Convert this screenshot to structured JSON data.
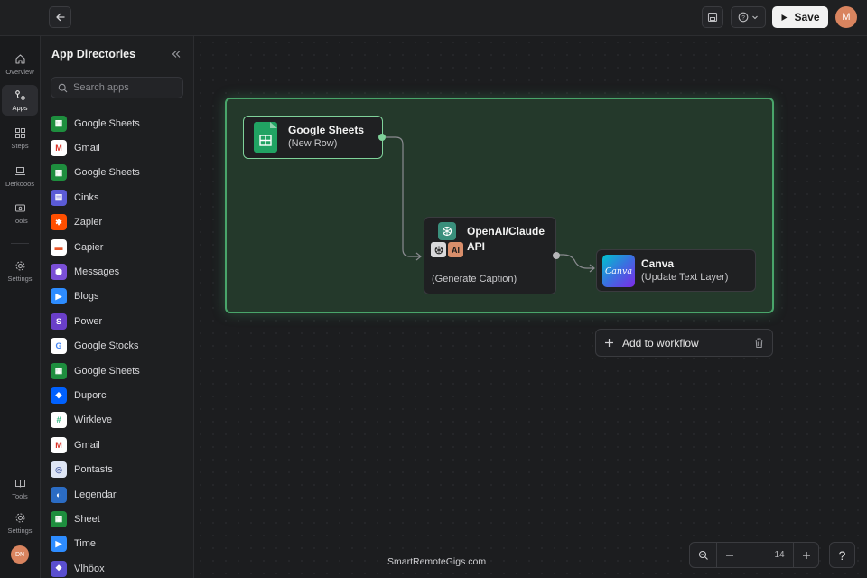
{
  "topbar": {
    "save_label": "Save",
    "avatar_initial": "M"
  },
  "rail": {
    "items": [
      {
        "label": "Overview",
        "icon": "home-icon"
      },
      {
        "label": "Apps",
        "icon": "apps-icon"
      },
      {
        "label": "Steps",
        "icon": "grid-icon"
      },
      {
        "label": "Derkooos",
        "icon": "laptop-icon"
      },
      {
        "label": "Tools",
        "icon": "toolbox-icon"
      },
      {
        "label": "Settings",
        "icon": "gear-icon"
      },
      {
        "label": "Tools",
        "icon": "book-icon"
      },
      {
        "label": "Settings",
        "icon": "gear-icon"
      }
    ],
    "avatar_initials": "DN"
  },
  "panel": {
    "title": "App Directories",
    "search_placeholder": "Search apps",
    "apps": [
      {
        "name": "Google Sheets",
        "icon": "sheets-icon",
        "color": "#1e8e3e"
      },
      {
        "name": "Gmail",
        "icon": "gmail-icon",
        "color": "#ffffff"
      },
      {
        "name": "Google Sheets",
        "icon": "sheets-icon",
        "color": "#1e8e3e"
      },
      {
        "name": "Cinks",
        "icon": "doc-icon",
        "color": "#5b5bd6"
      },
      {
        "name": "Zapier",
        "icon": "zapier-icon",
        "color": "#ff4f00"
      },
      {
        "name": "Capier",
        "icon": "capier-icon",
        "color": "#ffffff"
      },
      {
        "name": "Messages",
        "icon": "messages-icon",
        "color": "#7a4fd6"
      },
      {
        "name": "Blogs",
        "icon": "video-icon",
        "color": "#2d8cff"
      },
      {
        "name": "Power",
        "icon": "power-icon",
        "color": "#6a3fc9"
      },
      {
        "name": "Google Stocks",
        "icon": "google-icon",
        "color": "#ffffff"
      },
      {
        "name": "Google Sheets",
        "icon": "sheets-icon",
        "color": "#1e8e3e"
      },
      {
        "name": "Duporc",
        "icon": "dropbox-icon",
        "color": "#0061fe"
      },
      {
        "name": "Wirklеve",
        "icon": "slack-icon",
        "color": "#ffffff"
      },
      {
        "name": "Gmail",
        "icon": "gmail-icon",
        "color": "#ffffff"
      },
      {
        "name": "Pontasts",
        "icon": "pontasts-icon",
        "color": "#dfe6f5"
      },
      {
        "name": "Legendar",
        "icon": "legendar-icon",
        "color": "#2b6cc4"
      },
      {
        "name": "Sheet",
        "icon": "sheets-icon",
        "color": "#1e8e3e"
      },
      {
        "name": "Time",
        "icon": "video-icon",
        "color": "#2d8cff"
      },
      {
        "name": "Vlhöox",
        "icon": "vlhoox-icon",
        "color": "#5a4fcf"
      }
    ]
  },
  "nodes": {
    "sheets": {
      "title": "Google Sheets",
      "subtitle": "(New Row)"
    },
    "openai": {
      "title_line1": "OpenAI/Claude",
      "title_line2": "API",
      "ai_badge": "AI",
      "subtitle": "(Generate Caption)"
    },
    "canva": {
      "title": "Canva",
      "subtitle": "(Update Text Layer)",
      "logo_text": "Canva"
    }
  },
  "add_workflow_label": "Add to workflow",
  "zoom": {
    "value": "14"
  },
  "help_label": "?",
  "watermark": "SmartRemoteGigs.com",
  "colors": {
    "accent_green": "#49a56a",
    "group_fill": "#24392b",
    "avatar": "#d9845f"
  }
}
